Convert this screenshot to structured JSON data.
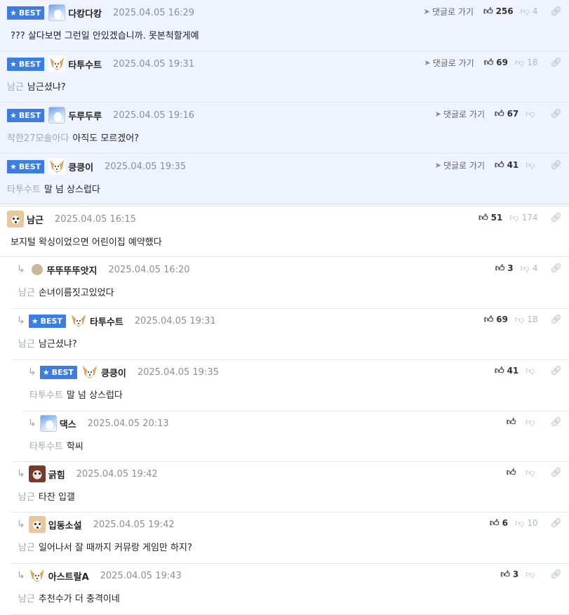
{
  "labels": {
    "goto": "댓글로 가기",
    "best": "BEST"
  },
  "best": [
    {
      "nick": "다캉다캉",
      "date": "2025.04.05 16:29",
      "mention": "",
      "text": "??? 살다보면 그런일 안있겠습니까. 못본척할게예",
      "up": "256",
      "down": "4",
      "avatar": "blue"
    },
    {
      "nick": "타투수트",
      "date": "2025.04.05 19:31",
      "mention": "남근",
      "text": "남근셨냐?",
      "up": "69",
      "down": "18",
      "avatar": "fox"
    },
    {
      "nick": "두루두루",
      "date": "2025.04.05 19:16",
      "mention": "착한27모솔아다",
      "text": "아직도 모르겠어?",
      "up": "67",
      "down": "",
      "avatar": "blue"
    },
    {
      "nick": "킁킁이",
      "date": "2025.04.05 19:35",
      "mention": "타투수트",
      "text": "말 넘 상스럽다",
      "up": "41",
      "down": "",
      "avatar": "fox"
    }
  ],
  "comments": [
    {
      "level": 0,
      "best": false,
      "nick": "남근",
      "date": "2025.04.05 16:15",
      "mention": "",
      "text": "보지털 왁싱이었으면 어린이집 예약했다",
      "up": "51",
      "down": "174",
      "avatar": "dog"
    },
    {
      "level": 1,
      "best": false,
      "nick": "뚜뚜뚜뚜앗지",
      "date": "2025.04.05 16:20",
      "mention": "남근",
      "text": "손녀이름짓고있었다",
      "up": "3",
      "down": "4",
      "avatar": "dot"
    },
    {
      "level": 1,
      "best": true,
      "nick": "타투수트",
      "date": "2025.04.05 19:31",
      "mention": "남근",
      "text": "남근셨냐?",
      "up": "69",
      "down": "18",
      "avatar": "fox"
    },
    {
      "level": 2,
      "best": true,
      "nick": "킁킁이",
      "date": "2025.04.05 19:35",
      "mention": "타투수트",
      "text": "말 넘 상스럽다",
      "up": "41",
      "down": "",
      "avatar": "fox"
    },
    {
      "level": 2,
      "best": false,
      "nick": "댁스",
      "date": "2025.04.05 20:13",
      "mention": "타투수트",
      "text": "학씨",
      "up": "",
      "down": "",
      "avatar": "blue"
    },
    {
      "level": 1,
      "best": false,
      "nick": "긁힘",
      "date": "2025.04.05 19:42",
      "mention": "남근",
      "text": "타잔 입갤",
      "up": "",
      "down": "",
      "avatar": "red"
    },
    {
      "level": 1,
      "best": false,
      "nick": "입동소설",
      "date": "2025.04.05 19:42",
      "mention": "남근",
      "text": "일어나서 잘 때까지 커뮤랑 게임만 하지?",
      "up": "6",
      "down": "10",
      "avatar": "dog"
    },
    {
      "level": 1,
      "best": false,
      "nick": "아스트랄A",
      "date": "2025.04.05 19:43",
      "mention": "남근",
      "text": "추천수가 더 충격이네",
      "up": "3",
      "down": "",
      "avatar": "fox"
    }
  ]
}
